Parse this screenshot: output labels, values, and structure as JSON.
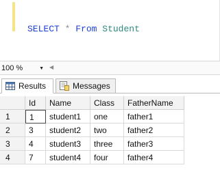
{
  "editor": {
    "select_kw": "SELECT",
    "star": "*",
    "from_kw": "From",
    "table": "Student"
  },
  "zoom": {
    "level": "100 %"
  },
  "tabs": [
    {
      "label": "Results",
      "icon": "grid-icon"
    },
    {
      "label": "Messages",
      "icon": "messages-icon"
    }
  ],
  "grid": {
    "columns": [
      "Id",
      "Name",
      "Class",
      "FatherName"
    ],
    "rows": [
      {
        "num": "1",
        "cells": [
          "1",
          "student1",
          "one",
          "father1"
        ]
      },
      {
        "num": "2",
        "cells": [
          "3",
          "student2",
          "two",
          "father2"
        ]
      },
      {
        "num": "3",
        "cells": [
          "4",
          "student3",
          "three",
          "father3"
        ]
      },
      {
        "num": "4",
        "cells": [
          "7",
          "student4",
          "four",
          "father4"
        ]
      }
    ]
  }
}
